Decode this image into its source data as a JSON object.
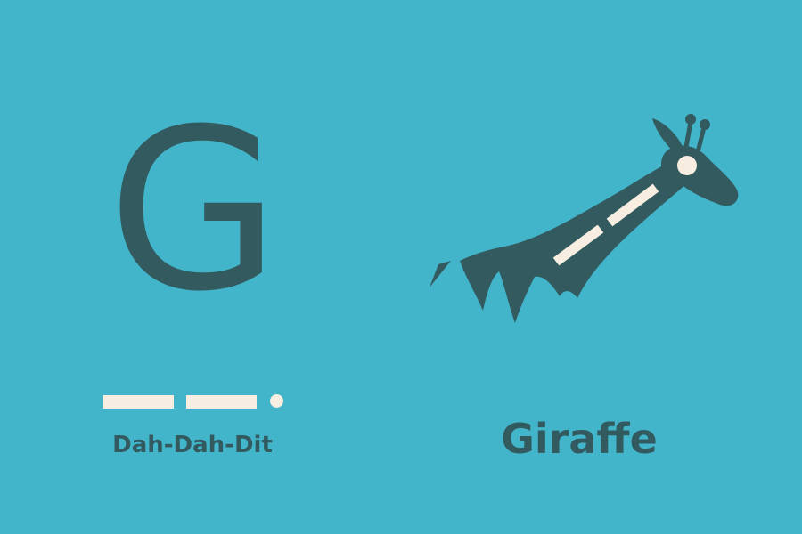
{
  "card": {
    "letter": "G",
    "morse": {
      "symbols": [
        "dah",
        "dah",
        "dit"
      ],
      "label": "Dah-Dah-Dit"
    },
    "word": "Giraffe",
    "illustration_icon": "giraffe-icon"
  },
  "colors": {
    "background": "#42b5cb",
    "ink": "#335b5f",
    "accent": "#f7ede0"
  }
}
